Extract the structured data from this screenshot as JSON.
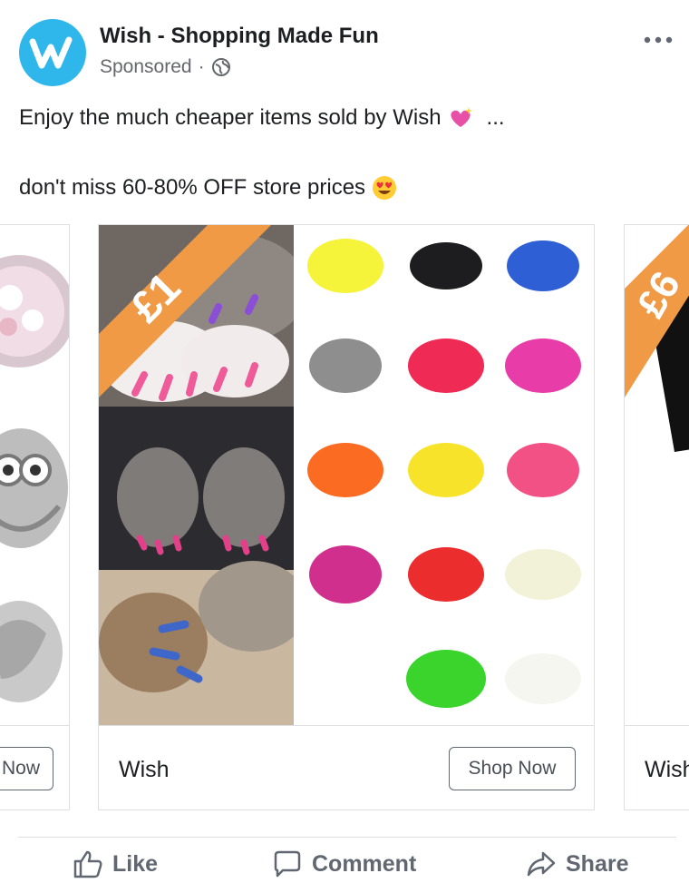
{
  "post": {
    "page_name": "Wish - Shopping Made Fun",
    "sponsored": "Sponsored",
    "separator": "·",
    "text_line1": "Enjoy the much cheaper items sold by Wish",
    "see_more": "...",
    "text_line2": "don't miss 60-80% OFF store prices",
    "brand_color": "#2fb7ec"
  },
  "carousel": {
    "left_card": {
      "button": "Now"
    },
    "main_card": {
      "price_banner": "£1",
      "title": "Wish",
      "button": "Shop Now",
      "banner_color": "#f09a46"
    },
    "right_card": {
      "price_banner": "£6",
      "title": "Wish"
    }
  },
  "actions": {
    "like": "Like",
    "comment": "Comment",
    "share": "Share"
  }
}
